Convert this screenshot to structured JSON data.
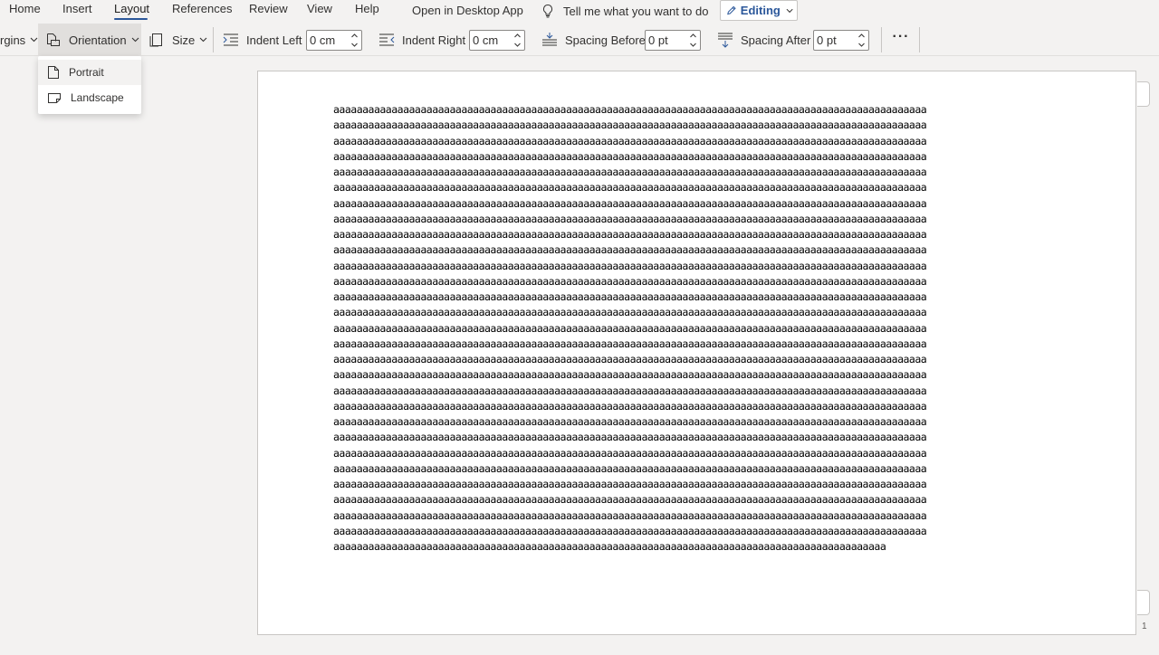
{
  "menu": {
    "tabs": [
      "Home",
      "Insert",
      "Layout",
      "References",
      "Review",
      "View",
      "Help"
    ],
    "active_tab": "Layout",
    "open_desktop": "Open in Desktop App",
    "tell_me": "Tell me what you want to do",
    "editing": "Editing"
  },
  "ribbon": {
    "margins_label": "rgins",
    "orientation_label": "Orientation",
    "size_label": "Size",
    "indent_left_label": "Indent Left",
    "indent_left_value": "0 cm",
    "indent_right_label": "Indent Right",
    "indent_right_value": "0 cm",
    "spacing_before_label": "Spacing Before",
    "spacing_before_value": "0 pt",
    "spacing_after_label": "Spacing After",
    "spacing_after_value": "0 pt",
    "more_label": "···"
  },
  "orientation_menu": {
    "items": [
      "Portrait",
      "Landscape"
    ]
  },
  "document": {
    "lines": [
      "aaaaaaaaaaaaaaaaaaaaaaaaaaaaaaaaaaaaaaaaaaaaaaaaaaaaaaaaaaaaaaaaaaaaaaaaaaaaaaaaaaaaaaaaaaaaaaaaaaaaaa",
      "aaaaaaaaaaaaaaaaaaaaaaaaaaaaaaaaaaaaaaaaaaaaaaaaaaaaaaaaaaaaaaaaaaaaaaaaaaaaaaaaaaaaaaaaaaaaaaaaaaaaaa",
      "aaaaaaaaaaaaaaaaaaaaaaaaaaaaaaaaaaaaaaaaaaaaaaaaaaaaaaaaaaaaaaaaaaaaaaaaaaaaaaaaaaaaaaaaaaaaaaaaaaaaaa",
      "aaaaaaaaaaaaaaaaaaaaaaaaaaaaaaaaaaaaaaaaaaaaaaaaaaaaaaaaaaaaaaaaaaaaaaaaaaaaaaaaaaaaaaaaaaaaaaaaaaaaaa",
      "aaaaaaaaaaaaaaaaaaaaaaaaaaaaaaaaaaaaaaaaaaaaaaaaaaaaaaaaaaaaaaaaaaaaaaaaaaaaaaaaaaaaaaaaaaaaaaaaaaaaaa",
      "aaaaaaaaaaaaaaaaaaaaaaaaaaaaaaaaaaaaaaaaaaaaaaaaaaaaaaaaaaaaaaaaaaaaaaaaaaaaaaaaaaaaaaaaaaaaaaaaaaaaaa",
      "aaaaaaaaaaaaaaaaaaaaaaaaaaaaaaaaaaaaaaaaaaaaaaaaaaaaaaaaaaaaaaaaaaaaaaaaaaaaaaaaaaaaaaaaaaaaaaaaaaaaaa",
      "aaaaaaaaaaaaaaaaaaaaaaaaaaaaaaaaaaaaaaaaaaaaaaaaaaaaaaaaaaaaaaaaaaaaaaaaaaaaaaaaaaaaaaaaaaaaaaaaaaaaaa",
      "aaaaaaaaaaaaaaaaaaaaaaaaaaaaaaaaaaaaaaaaaaaaaaaaaaaaaaaaaaaaaaaaaaaaaaaaaaaaaaaaaaaaaaaaaaaaaaaaaaaaaa",
      "aaaaaaaaaaaaaaaaaaaaaaaaaaaaaaaaaaaaaaaaaaaaaaaaaaaaaaaaaaaaaaaaaaaaaaaaaaaaaaaaaaaaaaaaaaaaaaaaaaaaaa",
      "aaaaaaaaaaaaaaaaaaaaaaaaaaaaaaaaaaaaaaaaaaaaaaaaaaaaaaaaaaaaaaaaaaaaaaaaaaaaaaaaaaaaaaaaaaaaaaaaaaaaaa",
      "aaaaaaaaaaaaaaaaaaaaaaaaaaaaaaaaaaaaaaaaaaaaaaaaaaaaaaaaaaaaaaaaaaaaaaaaaaaaaaaaaaaaaaaaaaaaaaaaaaaaaa",
      "aaaaaaaaaaaaaaaaaaaaaaaaaaaaaaaaaaaaaaaaaaaaaaaaaaaaaaaaaaaaaaaaaaaaaaaaaaaaaaaaaaaaaaaaaaaaaaaaaaaaaa",
      "aaaaaaaaaaaaaaaaaaaaaaaaaaaaaaaaaaaaaaaaaaaaaaaaaaaaaaaaaaaaaaaaaaaaaaaaaaaaaaaaaaaaaaaaaaaaaaaaaaaaaa",
      "aaaaaaaaaaaaaaaaaaaaaaaaaaaaaaaaaaaaaaaaaaaaaaaaaaaaaaaaaaaaaaaaaaaaaaaaaaaaaaaaaaaaaaaaaaaaaaaaaaaaaa",
      "aaaaaaaaaaaaaaaaaaaaaaaaaaaaaaaaaaaaaaaaaaaaaaaaaaaaaaaaaaaaaaaaaaaaaaaaaaaaaaaaaaaaaaaaaaaaaaaaaaaaaa",
      "aaaaaaaaaaaaaaaaaaaaaaaaaaaaaaaaaaaaaaaaaaaaaaaaaaaaaaaaaaaaaaaaaaaaaaaaaaaaaaaaaaaaaaaaaaaaaaaaaaaaaa",
      "aaaaaaaaaaaaaaaaaaaaaaaaaaaaaaaaaaaaaaaaaaaaaaaaaaaaaaaaaaaaaaaaaaaaaaaaaaaaaaaaaaaaaaaaaaaaaaaaaaaaaa",
      "aaaaaaaaaaaaaaaaaaaaaaaaaaaaaaaaaaaaaaaaaaaaaaaaaaaaaaaaaaaaaaaaaaaaaaaaaaaaaaaaaaaaaaaaaaaaaaaaaaaaaa",
      "aaaaaaaaaaaaaaaaaaaaaaaaaaaaaaaaaaaaaaaaaaaaaaaaaaaaaaaaaaaaaaaaaaaaaaaaaaaaaaaaaaaaaaaaaaaaaaaaaaaaaa",
      "aaaaaaaaaaaaaaaaaaaaaaaaaaaaaaaaaaaaaaaaaaaaaaaaaaaaaaaaaaaaaaaaaaaaaaaaaaaaaaaaaaaaaaaaaaaaaaaaaaaaaa",
      "aaaaaaaaaaaaaaaaaaaaaaaaaaaaaaaaaaaaaaaaaaaaaaaaaaaaaaaaaaaaaaaaaaaaaaaaaaaaaaaaaaaaaaaaaaaaaaaaaaaaaa",
      "aaaaaaaaaaaaaaaaaaaaaaaaaaaaaaaaaaaaaaaaaaaaaaaaaaaaaaaaaaaaaaaaaaaaaaaaaaaaaaaaaaaaaaaaaaaaaaaaaaaaaa",
      "aaaaaaaaaaaaaaaaaaaaaaaaaaaaaaaaaaaaaaaaaaaaaaaaaaaaaaaaaaaaaaaaaaaaaaaaaaaaaaaaaaaaaaaaaaaaaaaaaaaaaa",
      "aaaaaaaaaaaaaaaaaaaaaaaaaaaaaaaaaaaaaaaaaaaaaaaaaaaaaaaaaaaaaaaaaaaaaaaaaaaaaaaaaaaaaaaaaaaaaaaaaaaaaa",
      "aaaaaaaaaaaaaaaaaaaaaaaaaaaaaaaaaaaaaaaaaaaaaaaaaaaaaaaaaaaaaaaaaaaaaaaaaaaaaaaaaaaaaaaaaaaaaaaaaaaaaa",
      "aaaaaaaaaaaaaaaaaaaaaaaaaaaaaaaaaaaaaaaaaaaaaaaaaaaaaaaaaaaaaaaaaaaaaaaaaaaaaaaaaaaaaaaaaaaaaaaaaaaaaa",
      "aaaaaaaaaaaaaaaaaaaaaaaaaaaaaaaaaaaaaaaaaaaaaaaaaaaaaaaaaaaaaaaaaaaaaaaaaaaaaaaaaaaaaaaaaaaaaaaaaaaaaa",
      "aaaaaaaaaaaaaaaaaaaaaaaaaaaaaaaaaaaaaaaaaaaaaaaaaaaaaaaaaaaaaaaaaaaaaaaaaaaaaaaaaaaaaaaaaaaaaaa"
    ],
    "page_number": "1"
  },
  "colors": {
    "accent": "#2b579a",
    "ribbon_bg": "#f3f2f1",
    "page_bg": "#ffffff"
  }
}
